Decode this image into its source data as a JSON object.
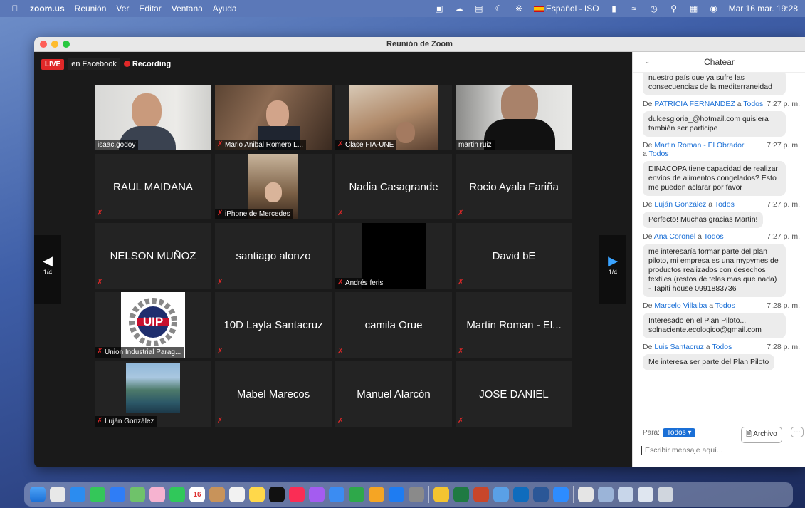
{
  "menubar": {
    "app": "zoom.us",
    "menus": [
      "Reunión",
      "Ver",
      "Editar",
      "Ventana",
      "Ayuda"
    ],
    "input_source": "Español - ISO",
    "datetime": "Mar 16 mar.  19:28"
  },
  "window": {
    "title": "Reunión de Zoom"
  },
  "badges": {
    "live": "LIVE",
    "facebook": "en Facebook",
    "recording": "Recording"
  },
  "pager": {
    "left": "1/4",
    "right": "1/4"
  },
  "tiles": [
    {
      "name": "isaac.godoy"
    },
    {
      "name": "Mario Anibal Romero L..."
    },
    {
      "name": "Clase FIA-UNE"
    },
    {
      "name": "martin ruiz"
    },
    {
      "name": "RAUL MAIDANA"
    },
    {
      "name": "iPhone de Mercedes"
    },
    {
      "name": "Nadia Casagrande"
    },
    {
      "name": "Rocio Ayala Fariña"
    },
    {
      "name": "NELSON MUÑOZ"
    },
    {
      "name": "santiago alonzo"
    },
    {
      "name": "Andrés feris"
    },
    {
      "name": "David bE"
    },
    {
      "name": "Union Industrial Parag..."
    },
    {
      "name": "10D Layla Santacruz"
    },
    {
      "name": "camila Orue"
    },
    {
      "name": "Martin Roman - El..."
    },
    {
      "name": "Luján González"
    },
    {
      "name": "Mabel Marecos"
    },
    {
      "name": "Manuel Alarcón"
    },
    {
      "name": "JOSE DANIEL"
    }
  ],
  "uip_logo_text": "UIP",
  "chat": {
    "title": "Chatear",
    "messages": [
      {
        "from": "",
        "to": "",
        "time": "",
        "text": "nuestro país que ya sufre las consecuencias de la mediterraneidad"
      },
      {
        "from": "PATRICIA FERNANDEZ",
        "to": "Todos",
        "time": "7:27 p. m.",
        "text": "dulcesgloria_@hotmail.com quisiera también ser participe"
      },
      {
        "from": "Martin Roman - El Obrador",
        "to": "Todos",
        "time": "7:27 p. m.",
        "text": "DINACOPA tiene capacidad de realizar envíos de alimentos congelados? Esto me pueden aclarar por favor"
      },
      {
        "from": "Luján González",
        "to": "Todos",
        "time": "7:27 p. m.",
        "text": "Perfecto! Muchas gracias Martin!"
      },
      {
        "from": "Ana Coronel",
        "to": "Todos",
        "time": "7:27 p. m.",
        "text": "me interesaría formar parte del plan piloto, mi empresa es una mypymes de productos realizados con desechos textiles (restos de telas mas que nada) - Tapiti house 0991883736"
      },
      {
        "from": "Marcelo Villalba",
        "to": "Todos",
        "time": "7:28 p. m.",
        "text": "Interesado en el Plan Piloto... solnaciente.ecologico@gmail.com"
      },
      {
        "from": "Luis Santacruz",
        "to": "Todos",
        "time": "7:28 p. m.",
        "text": "Me interesa ser parte del Plan Piloto"
      }
    ],
    "de": "De",
    "a": "a",
    "to_label": "Para:",
    "to_value": "Todos",
    "file_button": "Archivo",
    "more_button": "···",
    "input_placeholder": "Escribir mensaje aquí..."
  },
  "dock": {
    "calendar_day": "16"
  }
}
